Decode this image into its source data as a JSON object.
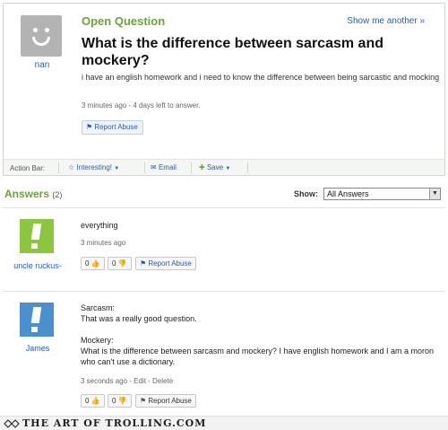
{
  "question": {
    "asker_name": "nan",
    "status": "Open Question",
    "show_another": "Show me another »",
    "title": "What is the difference between sarcasm and mockery?",
    "body": "i have an english homework and i need to know the difference between being sarcastic and mocking",
    "meta": "3 minutes ago - 4 days left to answer.",
    "report_label": "Report Abuse"
  },
  "action_bar": {
    "label": "Action Bar:",
    "interesting": "Interesting!",
    "email": "Email",
    "save": "Save"
  },
  "answers_header": {
    "title": "Answers",
    "count": "(2)",
    "show_label": "Show:",
    "show_value": "All Answers"
  },
  "answers": [
    {
      "name": "uncle ruckus-",
      "text": "everything",
      "meta": "3 minutes ago",
      "up_count": "0",
      "down_count": "0",
      "report_label": "Report Abuse",
      "avatar_color": "#8cc63f"
    },
    {
      "name": "James",
      "text_lines": [
        "Sarcasm:",
        "That was a really good question.",
        "",
        "Mockery:",
        "What is the difference between sarcasm and mockery? I have english homework and I am a moron who can't use a dictionary."
      ],
      "meta": "3 seconds ago - Edit - Delete",
      "up_count": "0",
      "down_count": "0",
      "report_label": "Report Abuse",
      "avatar_color": "#4a90cf"
    }
  ],
  "watermark": "THE ART OF TROLLING.COM",
  "colors": {
    "accent_green": "#6ba33a",
    "link_blue": "#2a5db0"
  }
}
